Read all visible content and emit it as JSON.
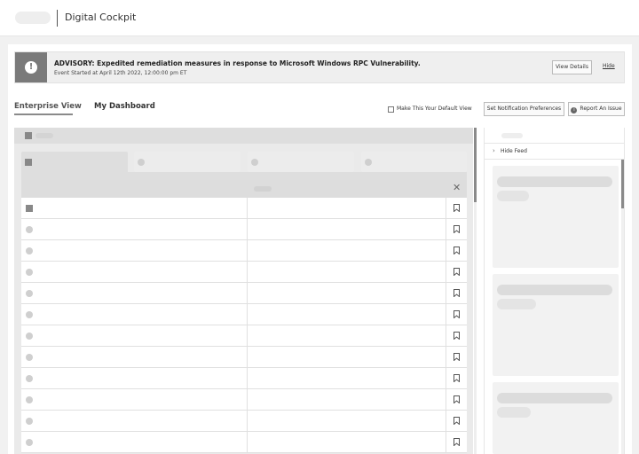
{
  "header": {
    "app_title": "Digital Cockpit"
  },
  "advisory": {
    "title": "ADVISORY: Expedited remediation measures in response to Microsoft Windows RPC Vulnerability.",
    "subtitle": "Event Started at April 12th 2022, 12:00:00 pm ET",
    "view_details_label": "View Details",
    "hide_label": "Hide",
    "icon": "alert-icon",
    "icon_glyph": "!"
  },
  "tabs": [
    {
      "label": "Enterprise View",
      "active": true
    },
    {
      "label": "My Dashboard",
      "active": false
    }
  ],
  "toolbar": {
    "default_view_label": "Make This Your Default View",
    "default_view_checked": false,
    "notification_label": "Set Notification Preferences",
    "report_label": "Report An Issue",
    "report_icon": "info-icon",
    "report_icon_glyph": "i"
  },
  "grid": {
    "close_glyph": "✕",
    "rows": [
      {
        "icon": "square"
      },
      {
        "icon": "circle"
      },
      {
        "icon": "circle"
      },
      {
        "icon": "circle"
      },
      {
        "icon": "circle"
      },
      {
        "icon": "circle"
      },
      {
        "icon": "circle"
      },
      {
        "icon": "circle"
      },
      {
        "icon": "circle"
      },
      {
        "icon": "circle"
      },
      {
        "icon": "circle"
      },
      {
        "icon": "circle"
      }
    ]
  },
  "feed": {
    "toggle_label": "Hide Feed",
    "chevron_glyph": "›"
  },
  "colors": {
    "advisory_icon_bg": "#7a7a7a",
    "placeholder": "#dcdcdc",
    "scroll_thumb": "#8a8a8a"
  }
}
